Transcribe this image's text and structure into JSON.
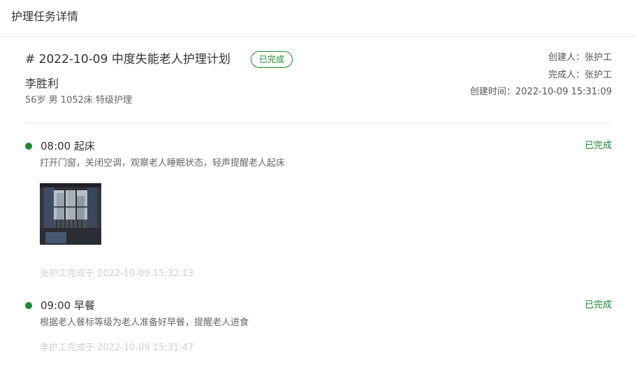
{
  "header": {
    "title": "护理任务详情"
  },
  "plan": {
    "title": "# 2022-10-09 中度失能老人护理计划",
    "status": "已完成",
    "elder_name": "李胜利",
    "elder_info": "56岁 男 1052床 特级护理",
    "creator": "创建人：张护工",
    "completer": "完成人：张护工",
    "created_time": "创建时间：2022-10-09 15:31:09"
  },
  "tasks": [
    {
      "time_label": "08:00 起床",
      "status": "已完成",
      "description": "打开门窗，关闭空调，观察老人睡眠状态，轻声提醒老人起床",
      "footer": "张护工完成于 2022-10-09 15:32:13"
    },
    {
      "time_label": "09:00 早餐",
      "status": "已完成",
      "description": "根据老人餐标等级为老人准备好早餐，提醒老人进食",
      "footer": "李护工完成于 2022-10-09 15:31:47"
    }
  ],
  "colors": {
    "accent": "#1a8a2e",
    "text": "#333333",
    "muted": "#666666",
    "faint": "#cfcfcf",
    "divider": "#ececec"
  }
}
